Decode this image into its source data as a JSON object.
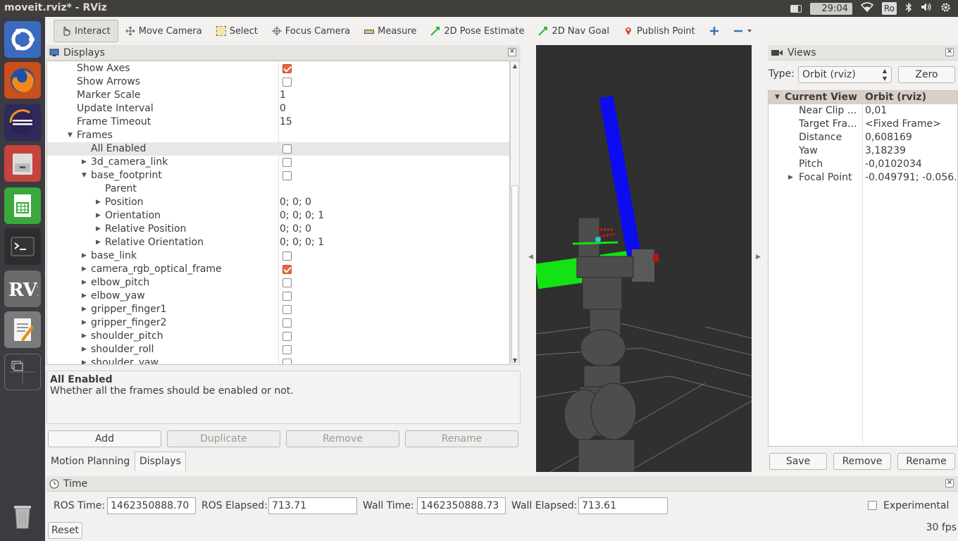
{
  "window": {
    "title": "moveit.rviz* - RViz"
  },
  "tray": {
    "clock": "29:04",
    "keyboard": "Ro"
  },
  "toolbar": {
    "interact": "Interact",
    "move_camera": "Move Camera",
    "select": "Select",
    "focus_camera": "Focus Camera",
    "measure": "Measure",
    "pose_estimate": "2D Pose Estimate",
    "nav_goal": "2D Nav Goal",
    "publish_point": "Publish Point"
  },
  "displays": {
    "title": "Displays",
    "rows": [
      {
        "name": "Show Axes",
        "value": "",
        "checkbox": true,
        "checked": true
      },
      {
        "name": "Show Arrows",
        "value": "",
        "checkbox": true,
        "checked": false
      },
      {
        "name": "Marker Scale",
        "value": "1"
      },
      {
        "name": "Update Interval",
        "value": "0"
      },
      {
        "name": "Frame Timeout",
        "value": "15"
      },
      {
        "name": "Frames",
        "value": ""
      },
      {
        "name": "All Enabled",
        "value": "",
        "checkbox": true,
        "checked": false
      },
      {
        "name": "3d_camera_link",
        "value": "",
        "checkbox": true,
        "checked": false
      },
      {
        "name": "base_footprint",
        "value": "",
        "checkbox": true,
        "checked": false
      },
      {
        "name": "Parent",
        "value": ""
      },
      {
        "name": "Position",
        "value": "0; 0; 0"
      },
      {
        "name": "Orientation",
        "value": "0; 0; 0; 1"
      },
      {
        "name": "Relative Position",
        "value": "0; 0; 0"
      },
      {
        "name": "Relative Orientation",
        "value": "0; 0; 0; 1"
      },
      {
        "name": "base_link",
        "value": "",
        "checkbox": true,
        "checked": false
      },
      {
        "name": "camera_rgb_optical_frame",
        "value": "",
        "checkbox": true,
        "checked": true
      },
      {
        "name": "elbow_pitch",
        "value": "",
        "checkbox": true,
        "checked": false
      },
      {
        "name": "elbow_yaw",
        "value": "",
        "checkbox": true,
        "checked": false
      },
      {
        "name": "gripper_finger1",
        "value": "",
        "checkbox": true,
        "checked": false
      },
      {
        "name": "gripper_finger2",
        "value": "",
        "checkbox": true,
        "checked": false
      },
      {
        "name": "shoulder_pitch",
        "value": "",
        "checkbox": true,
        "checked": false
      },
      {
        "name": "shoulder_roll",
        "value": "",
        "checkbox": true,
        "checked": false
      },
      {
        "name": "shoulder_yaw",
        "value": "",
        "checkbox": true,
        "checked": false
      }
    ],
    "desc_title": "All Enabled",
    "desc_text": "Whether all the frames should be enabled or not.",
    "buttons": {
      "add": "Add",
      "duplicate": "Duplicate",
      "remove": "Remove",
      "rename": "Rename"
    },
    "tabs": {
      "motion_planning": "Motion Planning",
      "displays": "Displays"
    }
  },
  "views": {
    "title": "Views",
    "type_label": "Type:",
    "type_value": "Orbit (rviz)",
    "zero": "Zero",
    "header_name": "Current View",
    "header_value": "Orbit (rviz)",
    "rows": [
      {
        "name": "Near Clip ...",
        "value": "0,01"
      },
      {
        "name": "Target Fra...",
        "value": "<Fixed Frame>"
      },
      {
        "name": "Distance",
        "value": "0,608169"
      },
      {
        "name": "Yaw",
        "value": "3,18239"
      },
      {
        "name": "Pitch",
        "value": "-0,0102034"
      },
      {
        "name": "Focal Point",
        "value": "-0.049791; -0.056..."
      }
    ],
    "buttons": {
      "save": "Save",
      "remove": "Remove",
      "rename": "Rename"
    }
  },
  "time": {
    "title": "Time",
    "ros_time_label": "ROS Time:",
    "ros_time": "1462350888.70",
    "ros_elapsed_label": "ROS Elapsed:",
    "ros_elapsed": "713.71",
    "wall_time_label": "Wall Time:",
    "wall_time": "1462350888.73",
    "wall_elapsed_label": "Wall Elapsed:",
    "wall_elapsed": "713.61",
    "experimental": "Experimental",
    "reset": "Reset",
    "fps": "30 fps"
  }
}
